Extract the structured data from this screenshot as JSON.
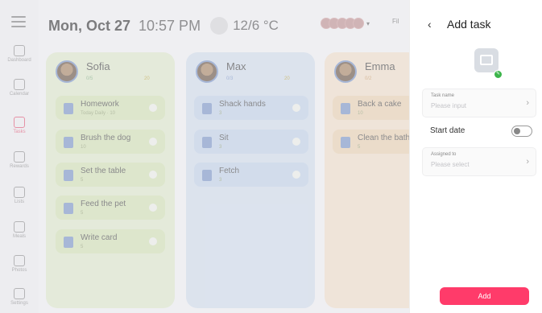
{
  "header": {
    "date": "Mon, Oct 27",
    "time": "10:57 PM",
    "weather": "12/6 °C",
    "weather_icon": "cloud-icon",
    "filter_label": "Fil"
  },
  "sidebar": {
    "items": [
      {
        "label": "Dashboard",
        "icon": "dashboard-icon"
      },
      {
        "label": "Calendar",
        "icon": "calendar-icon"
      },
      {
        "label": "Tasks",
        "icon": "tasks-icon",
        "active": true
      },
      {
        "label": "Rewards",
        "icon": "rewards-icon"
      },
      {
        "label": "Lists",
        "icon": "lists-icon"
      },
      {
        "label": "Meals",
        "icon": "meals-icon"
      },
      {
        "label": "Photos",
        "icon": "photos-icon"
      },
      {
        "label": "Settings",
        "icon": "settings-icon"
      }
    ]
  },
  "columns": [
    {
      "name": "Sofia",
      "progress": "0/5",
      "stars": "20",
      "tasks": [
        {
          "name": "Homework",
          "sub": "Today Daily  ·  10"
        },
        {
          "name": "Brush the dog",
          "sub": "10"
        },
        {
          "name": "Set the table",
          "sub": "5"
        },
        {
          "name": "Feed the pet",
          "sub": "5"
        },
        {
          "name": "Write card",
          "sub": "5"
        }
      ]
    },
    {
      "name": "Max",
      "progress": "0/3",
      "stars": "20",
      "tasks": [
        {
          "name": "Shack hands",
          "sub": "3"
        },
        {
          "name": "Sit",
          "sub": "3"
        },
        {
          "name": "Fetch",
          "sub": "3"
        }
      ]
    },
    {
      "name": "Emma",
      "progress": "0/2",
      "stars": "",
      "tasks": [
        {
          "name": "Back a cake",
          "sub": "10"
        },
        {
          "name": "Clean the bath",
          "sub": "5"
        }
      ]
    }
  ],
  "panel": {
    "title": "Add task",
    "task_name_label": "Task name",
    "task_name_placeholder": "Please input",
    "start_date_label": "Start date",
    "assigned_label": "Assigned to",
    "assigned_placeholder": "Please select",
    "add_label": "Add",
    "accent": "#ff3b6a"
  }
}
